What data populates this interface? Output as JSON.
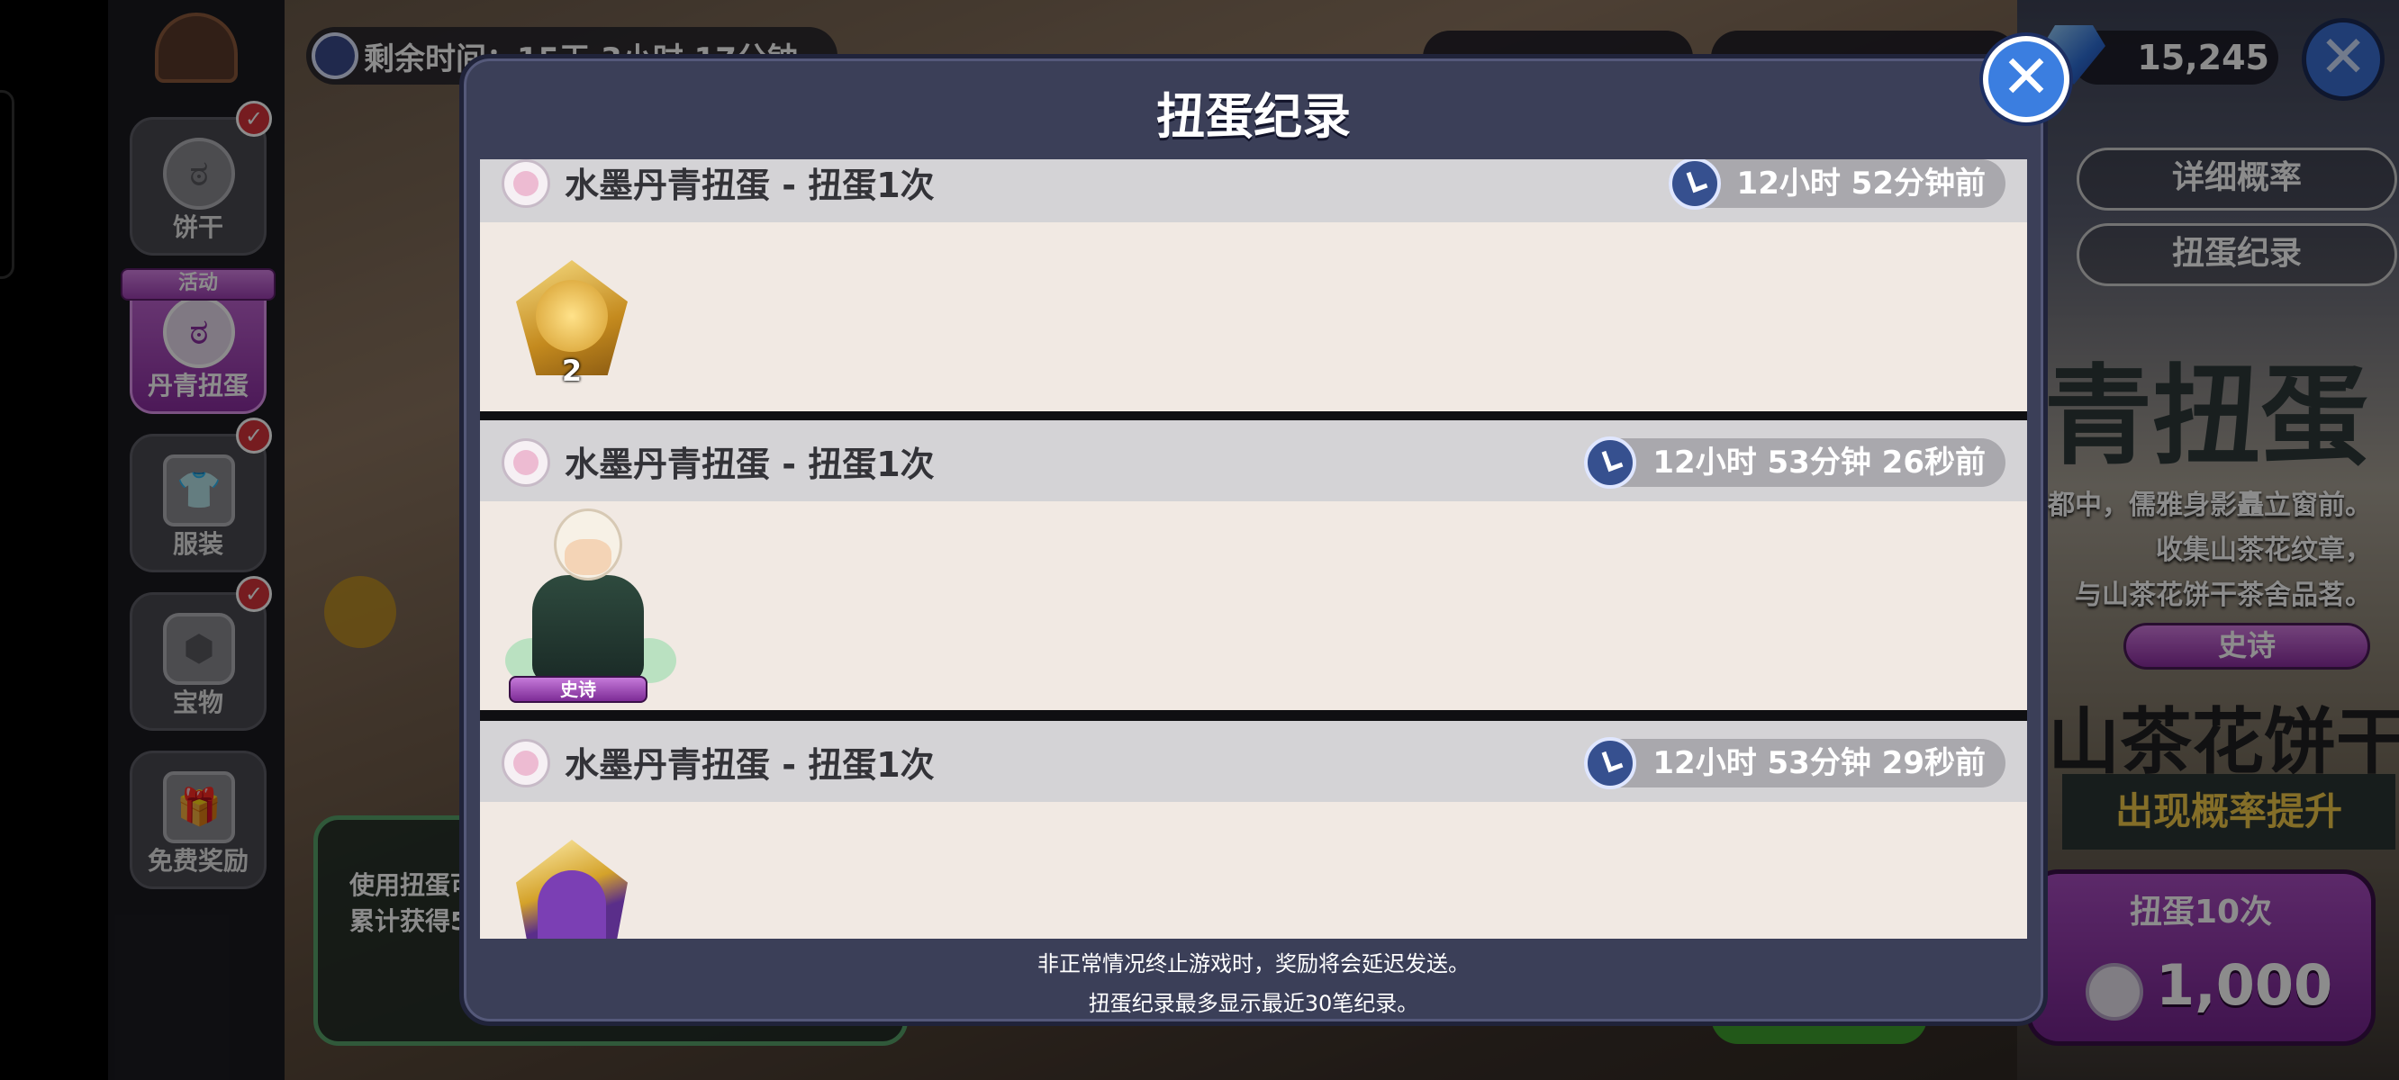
{
  "background": {
    "timer_text": "剩余时间：15天 3小时 17分钟",
    "gem_balance": "15,245",
    "sidebar": {
      "event_ribbon": "活动",
      "items": [
        {
          "label": "饼干",
          "checked": true
        },
        {
          "label": "丹青扭蛋",
          "checked": false,
          "active": true
        },
        {
          "label": "服装",
          "checked": true
        },
        {
          "label": "宝物",
          "checked": true
        },
        {
          "label": "免费奖励",
          "checked": false
        }
      ]
    },
    "right_panel": {
      "detail_rates_button": "详细概率",
      "pull_history_button": "扭蛋纪录",
      "banner_title": "青扭蛋",
      "desc_lines": [
        "都中，儒雅身影矗立窗前。",
        "收集山茶花纹章，",
        "与山茶花饼干茶舍品茗。"
      ],
      "rarity_badge": "史诗",
      "cookie_name": "山茶花饼干",
      "rate_up_label": "出现概率提升",
      "pull10_label": "扭蛋10次",
      "pull10_cost": "1,000"
    },
    "bottom_left": {
      "line1": "使用扭蛋可",
      "line2": "累计获得5"
    }
  },
  "modal": {
    "title": "扭蛋纪录",
    "records": [
      {
        "title": "水墨丹青扭蛋 - 扭蛋1次",
        "time": "12小时 52分钟前",
        "reward": "badge",
        "count": "2"
      },
      {
        "title": "水墨丹青扭蛋 - 扭蛋1次",
        "time": "12小时 53分钟 26秒前",
        "reward": "character",
        "rarity": "史诗"
      },
      {
        "title": "水墨丹青扭蛋 - 扭蛋1次",
        "time": "12小时 53分钟 29秒前",
        "reward": "badge"
      }
    ],
    "footer_line1": "非正常情况终止游戏时，奖励将会延迟发送。",
    "footer_line2": "扭蛋纪录最多显示最近30笔纪录。"
  },
  "icons": {
    "close": "close-icon",
    "clock": "clock-icon",
    "gem": "gem-icon"
  },
  "colors": {
    "modal_bg": "#3b3f58",
    "record_bg": "#f1e9e3",
    "record_header_bg": "#d4d3d6",
    "accent_blue": "#3b7ee0",
    "epic_purple": "#8b2ea0"
  }
}
